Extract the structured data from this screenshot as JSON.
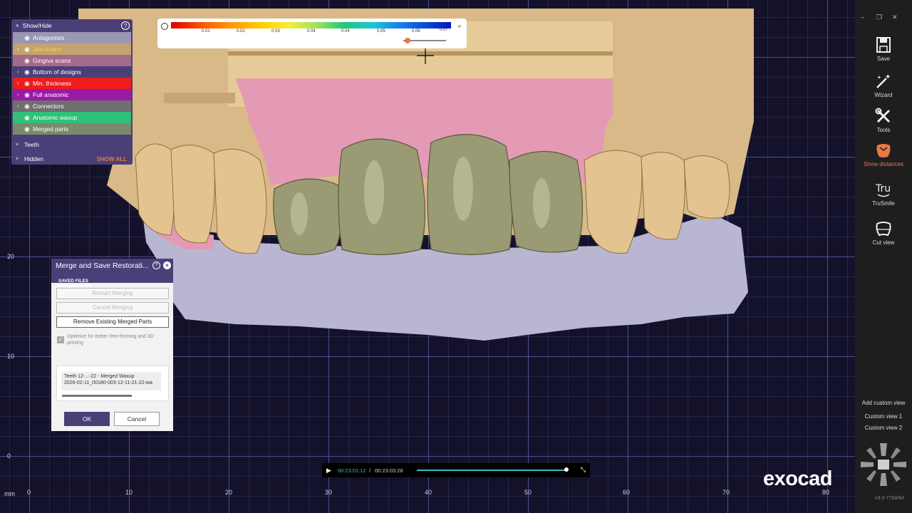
{
  "viewport": {
    "unit_label": "mm",
    "x_axis_labels": [
      "0",
      "10",
      "20",
      "30",
      "40",
      "50",
      "60",
      "70",
      "80"
    ],
    "y_axis_labels": [
      "20",
      "10",
      "0"
    ]
  },
  "showhide": {
    "title": "Show/Hide",
    "help": "?",
    "layers": [
      {
        "label": "Antagonists",
        "color": "#9a96b3",
        "text_color": "#ffffff",
        "expandable": false
      },
      {
        "label": "Jaw scans",
        "color": "#c4a46e",
        "text_color": "#f5d34a",
        "expandable": true
      },
      {
        "label": "Gingiva scans",
        "color": "#a46a8c",
        "text_color": "#ffffff",
        "expandable": false
      },
      {
        "label": "Bottom of designs",
        "color": "#4b3f78",
        "text_color": "#ffffff",
        "expandable": true
      },
      {
        "label": "Min. thickness",
        "color": "#ee1c1c",
        "text_color": "#ffffff",
        "expandable": true
      },
      {
        "label": "Full anatomic",
        "color": "#9a1aa6",
        "text_color": "#ffffff",
        "expandable": true
      },
      {
        "label": "Connectors",
        "color": "#6f6f6f",
        "text_color": "#ffffff",
        "expandable": true
      },
      {
        "label": "Anatomic waxup",
        "color": "#2fc07a",
        "text_color": "#ffffff",
        "expandable": false
      },
      {
        "label": "Merged parts",
        "color": "#7b8a6a",
        "text_color": "#ffffff",
        "expandable": false
      }
    ],
    "teeth_label": "Teeth",
    "hidden_label": "Hidden",
    "show_all_label": "SHOW ALL"
  },
  "colorscale": {
    "ticks": [
      "0.01",
      "0.02",
      "0.03",
      "0.04",
      "0.04",
      "0.05",
      "0.06",
      "0.07"
    ]
  },
  "merge_dialog": {
    "title": "Merge and Save Restorati...",
    "tab": "SAVED FILES",
    "restart_label": "Restart Merging",
    "cancel_merging_label": "Cancel Merging",
    "remove_label": "Remove Existing Merged Parts",
    "optimize_label": "Optimize for better free-forming and 3D printing",
    "file_line1": "Teeth 12-...-22 - Merged Waxup",
    "file_line2": "2026-02-11_00180-003-12-11-21-22-wa",
    "ok_label": "OK",
    "cancel_label": "Cancel"
  },
  "video": {
    "current_time": "00:23:01:12",
    "separator": "/",
    "total_time": "00:23:03:28",
    "progress": 0.99
  },
  "logo": "exocad",
  "toolbar": {
    "tools": [
      {
        "label": "Save",
        "icon": "save-icon"
      },
      {
        "label": "Wizard",
        "icon": "wizard-icon"
      },
      {
        "label": "Tools",
        "icon": "tools-icon"
      },
      {
        "label": "Show distances",
        "icon": "show-distances-icon",
        "active": true
      },
      {
        "label": "TruSmile",
        "icon": "trusmile-icon"
      },
      {
        "label": "Cut view",
        "icon": "cut-view-icon"
      }
    ],
    "add_custom_view": "Add custom view",
    "custom_view_1": "Custom view 1",
    "custom_view_2": "Custom view 2",
    "version": "v3.0-7754/64",
    "accent": "#e8794a"
  }
}
